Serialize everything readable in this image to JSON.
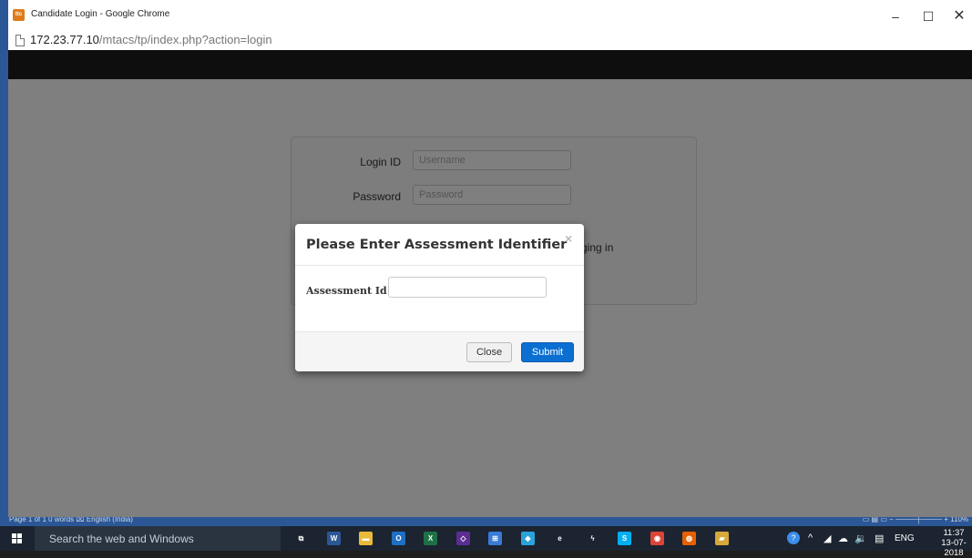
{
  "window": {
    "title": "Candidate Login - Google Chrome",
    "app_icon_text": "ttc",
    "controls": {
      "minimize": "–",
      "maximize": "☐",
      "close": "✕"
    }
  },
  "address": {
    "host": "172.23.77.10",
    "path": "/mtacs/tp/index.php?action=login"
  },
  "login_form": {
    "login_id_label": "Login ID",
    "login_id_placeholder": "Username",
    "password_label": "Password",
    "password_placeholder": "Password",
    "note_fragment": "ging in"
  },
  "modal": {
    "title": "Please Enter Assessment Identifier",
    "close_x": "×",
    "field_label": "Assessment Id",
    "field_value": "",
    "close_button": "Close",
    "submit_button": "Submit"
  },
  "word_status": {
    "left": "Page 1 of 1    0 words    ⌧    English (India)",
    "right": "▭   ▤   ▭   −  ────┼────  +  110%"
  },
  "taskbar": {
    "search_placeholder": "Search the web and Windows",
    "apps": [
      {
        "name": "task-view-icon",
        "glyph": "⧉",
        "color": "#1b2430"
      },
      {
        "name": "word-icon",
        "glyph": "W",
        "color": "#2b5797"
      },
      {
        "name": "file-explorer-icon",
        "glyph": "▬",
        "color": "#e8b93a"
      },
      {
        "name": "outlook-icon",
        "glyph": "O",
        "color": "#1f6fc5"
      },
      {
        "name": "excel-icon",
        "glyph": "X",
        "color": "#1e7145"
      },
      {
        "name": "visual-studio-icon",
        "glyph": "◇",
        "color": "#5c2d91"
      },
      {
        "name": "network-icon",
        "glyph": "⊞",
        "color": "#3a7bd5"
      },
      {
        "name": "paint-icon",
        "glyph": "◆",
        "color": "#2aa3d9"
      },
      {
        "name": "edge-icon",
        "glyph": "e",
        "color": "#1b2430"
      },
      {
        "name": "winamp-icon",
        "glyph": "ϟ",
        "color": "#1b2430"
      },
      {
        "name": "skype-icon",
        "glyph": "S",
        "color": "#00aff0"
      },
      {
        "name": "chrome-icon",
        "glyph": "◉",
        "color": "#db4437"
      },
      {
        "name": "firefox-icon",
        "glyph": "◍",
        "color": "#e66000"
      },
      {
        "name": "folder-icon",
        "glyph": "▰",
        "color": "#d7a93a"
      }
    ],
    "tray": {
      "help": "?",
      "chevron": "^",
      "language": "ENG"
    },
    "time": "11:37",
    "date": "13-07-2018"
  }
}
